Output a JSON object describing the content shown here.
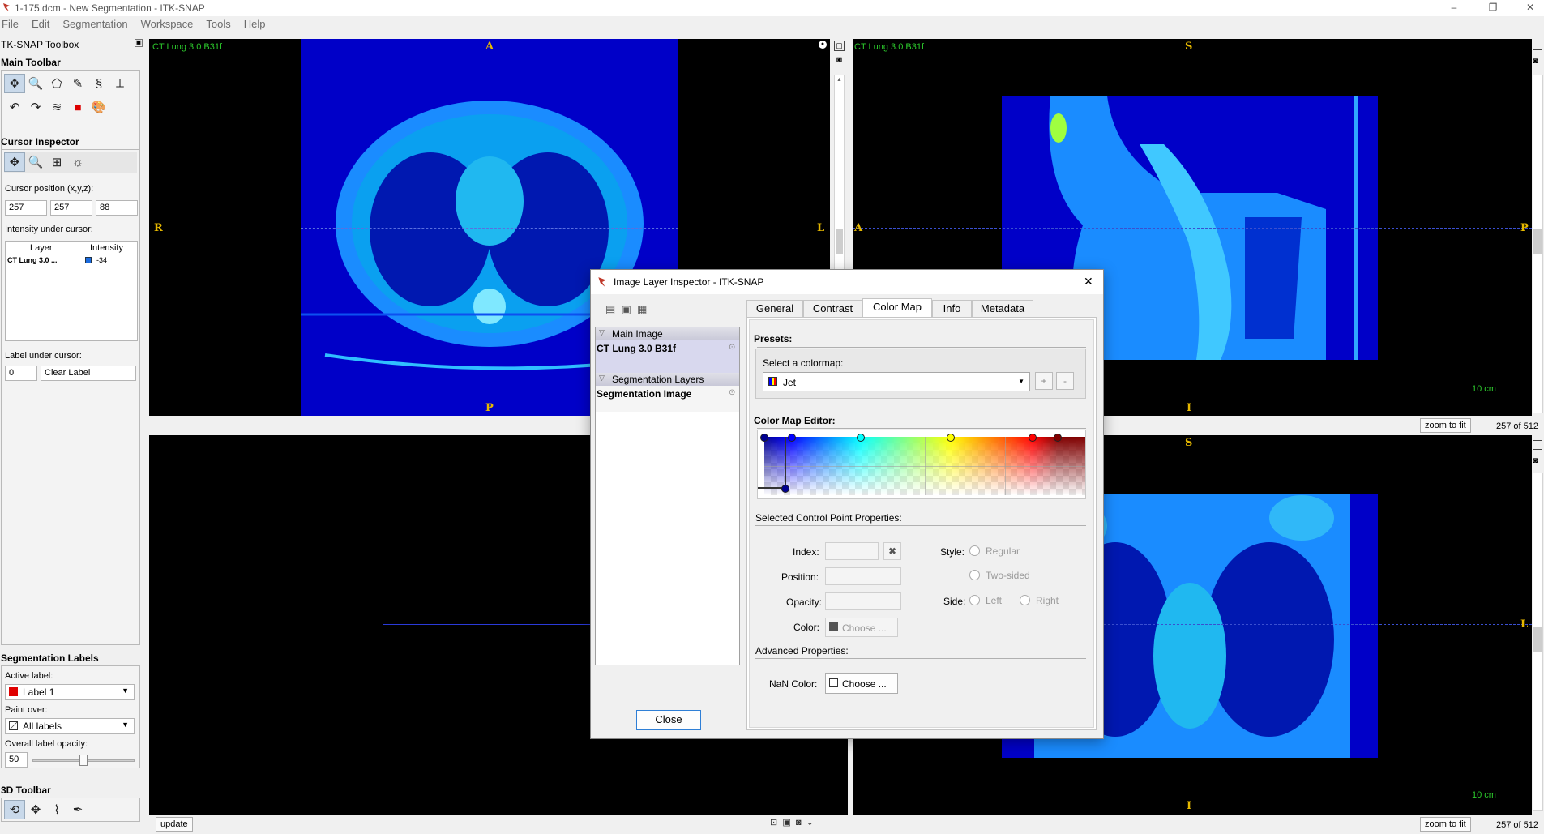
{
  "window": {
    "title": "1-175.dcm - New Segmentation - ITK-SNAP",
    "controls": [
      "–",
      "❐",
      "✕"
    ]
  },
  "menu": [
    "File",
    "Edit",
    "Segmentation",
    "Workspace",
    "Tools",
    "Help"
  ],
  "toolbox": {
    "title": "TK-SNAP Toolbox",
    "main_toolbar_title": "Main Toolbar",
    "cursor_inspector": {
      "title": "Cursor Inspector",
      "position_label": "Cursor position (x,y,z):",
      "x": "257",
      "y": "257",
      "z": "88",
      "intensity_label": "Intensity under cursor:",
      "table_headers": [
        "Layer",
        "Intensity"
      ],
      "rows": [
        {
          "layer": "CT Lung  3.0 ...",
          "intensity": "-34"
        }
      ],
      "label_under_cursor": "Label under cursor:",
      "label_id": "0",
      "label_name": "Clear Label"
    },
    "segmentation_labels": {
      "title": "Segmentation Labels",
      "active_label_caption": "Active label:",
      "active_label": "Label 1",
      "paint_over_caption": "Paint over:",
      "paint_over": "All labels",
      "opacity_caption": "Overall label opacity:",
      "opacity": "50"
    },
    "toolbar_3d_title": "3D Toolbar"
  },
  "views": {
    "axial": {
      "label": "CT Lung  3.0  B31f",
      "top": "A",
      "bottom": "P",
      "left": "R",
      "right": "L"
    },
    "sagittal": {
      "label": "CT Lung  3.0  B31f",
      "top": "S",
      "bottom": "I",
      "left": "A",
      "right": "P",
      "scale": "10 cm",
      "zoom_button": "zoom to fit",
      "slice": "257 of 512"
    },
    "coronal": {
      "top": "S",
      "bottom": "I",
      "right": "L",
      "scale": "10 cm",
      "zoom_button": "zoom to fit",
      "slice": "257 of 512"
    },
    "update_button": "update"
  },
  "dialog": {
    "title": "Image Layer Inspector - ITK-SNAP",
    "layers": {
      "main_header": "Main Image",
      "main_item": "CT Lung  3.0  B31f",
      "seg_header": "Segmentation Layers",
      "seg_item": "Segmentation Image"
    },
    "tabs": [
      "General",
      "Contrast",
      "Color Map",
      "Info",
      "Metadata"
    ],
    "active_tab": "Color Map",
    "presets_title": "Presets:",
    "select_colormap_label": "Select a colormap:",
    "colormap": "Jet",
    "add_preset": "+",
    "remove_preset": "-",
    "editor_title": "Color Map Editor:",
    "control_points": [
      {
        "position": 0.0,
        "color": "#00008f"
      },
      {
        "position": 0.085,
        "color": "#0000ff"
      },
      {
        "position": 0.3,
        "color": "#00ffff"
      },
      {
        "position": 0.58,
        "color": "#ffff00"
      },
      {
        "position": 0.835,
        "color": "#ff0000"
      },
      {
        "position": 0.915,
        "color": "#800000"
      }
    ],
    "selected_cp_title": "Selected Control Point Properties:",
    "index_label": "Index:",
    "position_label": "Position:",
    "opacity_label": "Opacity:",
    "color_label": "Color:",
    "choose": "Choose ...",
    "style_label": "Style:",
    "style_regular": "Regular",
    "style_two_sided": "Two-sided",
    "side_label": "Side:",
    "side_left": "Left",
    "side_right": "Right",
    "advanced_title": "Advanced Properties:",
    "nan_color_label": "NaN Color:",
    "nan_choose": "Choose ...",
    "close_button": "Close"
  }
}
